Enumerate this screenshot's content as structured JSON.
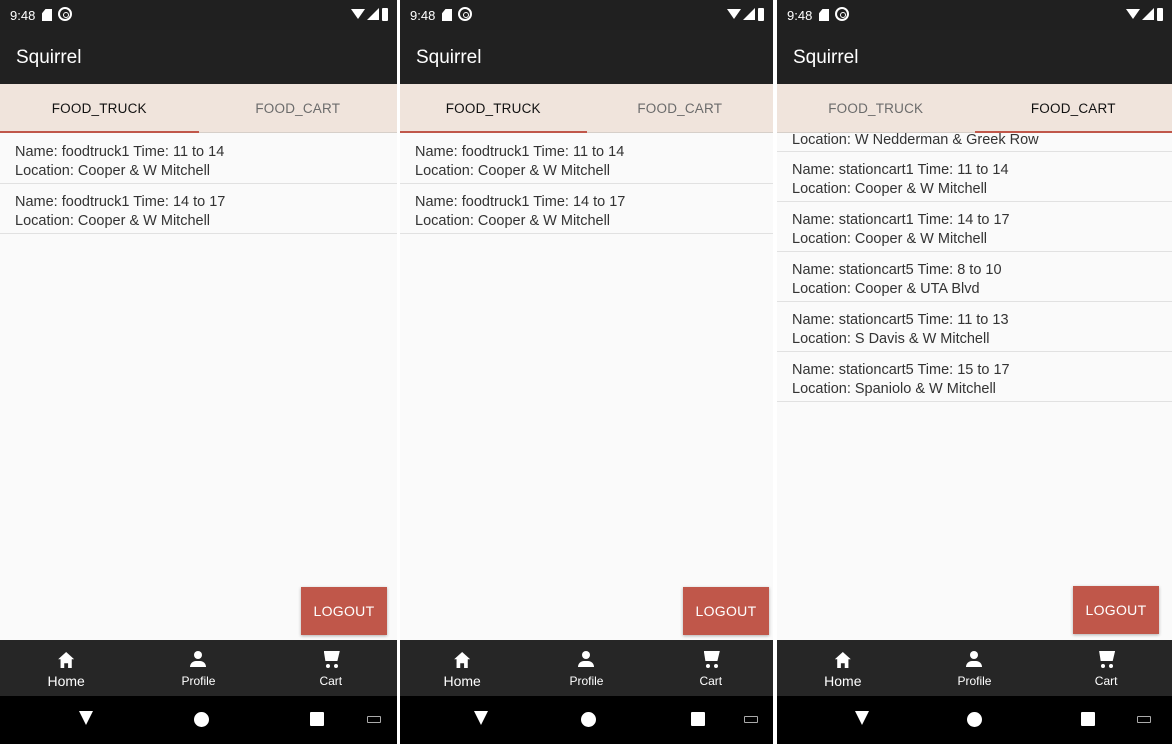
{
  "status": {
    "time": "9:48"
  },
  "app": {
    "title": "Squirrel"
  },
  "tabs": [
    "FOOD_TRUCK",
    "FOOD_CART"
  ],
  "screens": [
    {
      "active_tab": "FOOD_TRUCK",
      "items": [
        {
          "line1": "Name: foodtruck1 Time: 11 to 14",
          "line2": "Location: Cooper & W Mitchell"
        },
        {
          "line1": "Name: foodtruck1 Time: 14 to 17",
          "line2": "Location: Cooper & W Mitchell"
        }
      ]
    },
    {
      "active_tab": "FOOD_TRUCK",
      "items": [
        {
          "line1": "Name: foodtruck1 Time: 11 to 14",
          "line2": "Location: Cooper & W Mitchell"
        },
        {
          "line1": "Name: foodtruck1 Time: 14 to 17",
          "line2": "Location: Cooper & W Mitchell"
        }
      ]
    },
    {
      "active_tab": "FOOD_CART",
      "partial_top": "Location: W Nedderman & Greek Row",
      "items": [
        {
          "line1": "Name: stationcart1  Time: 11 to 14",
          "line2": "Location: Cooper & W Mitchell"
        },
        {
          "line1": "Name: stationcart1  Time: 14 to 17",
          "line2": "Location: Cooper & W Mitchell"
        },
        {
          "line1": "Name: stationcart5  Time: 8 to 10",
          "line2": "Location: Cooper & UTA Blvd"
        },
        {
          "line1": "Name: stationcart5  Time: 11 to 13",
          "line2": "Location: S Davis & W Mitchell"
        },
        {
          "line1": "Name: stationcart5  Time: 15 to 17",
          "line2": "Location: Spaniolo & W Mitchell"
        }
      ]
    }
  ],
  "logout_label": "LOGOUT",
  "nav": [
    {
      "label": "Home",
      "icon": "home-icon"
    },
    {
      "label": "Profile",
      "icon": "person-icon"
    },
    {
      "label": "Cart",
      "icon": "cart-icon"
    }
  ],
  "colors": {
    "appbar": "#212121",
    "tabbar": "#f0e4dc",
    "accent": "#c0574a",
    "bottom_nav": "#262626"
  }
}
